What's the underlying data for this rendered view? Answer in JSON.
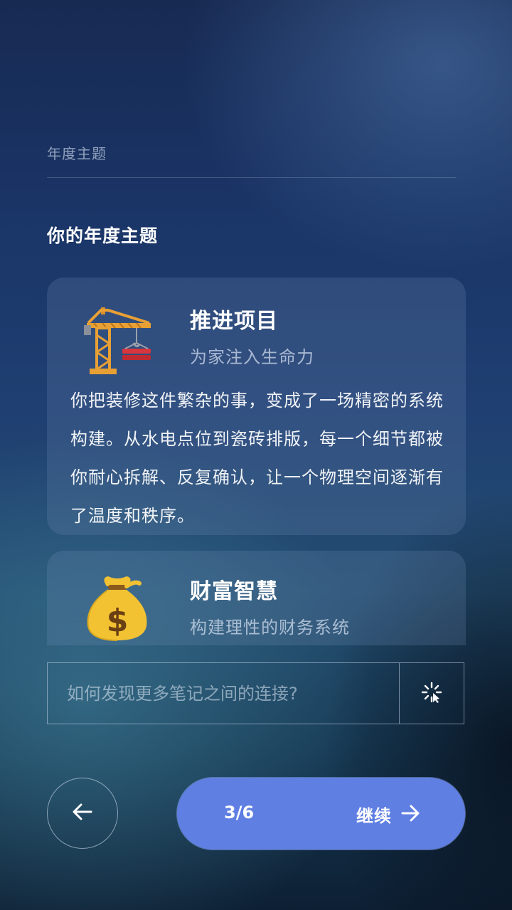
{
  "header": {
    "label": "年度主题"
  },
  "section": {
    "title": "你的年度主题"
  },
  "themes": [
    {
      "icon": "construction-crane-icon",
      "title": "推进项目",
      "subtitle": "为家注入生命力",
      "body": "你把装修这件繁杂的事，变成了一场精密的系统构建。从水电点位到瓷砖排版，每一个细节都被你耐心拆解、反复确认，让一个物理空间逐渐有了温度和秩序。"
    },
    {
      "icon": "money-bag-icon",
      "title": "财富智慧",
      "subtitle": "构建理性的财务系统"
    }
  ],
  "prompt": {
    "placeholder": "如何发现更多笔记之间的连接?",
    "action_icon": "sparkle-icon"
  },
  "navigation": {
    "back_icon": "arrow-left-icon",
    "step": "3/6",
    "continue_label": "继续",
    "continue_icon": "arrow-right-icon"
  },
  "colors": {
    "accent": "#5f7fe3",
    "crane": "#e8a035",
    "money_bag": "#f2c233"
  }
}
